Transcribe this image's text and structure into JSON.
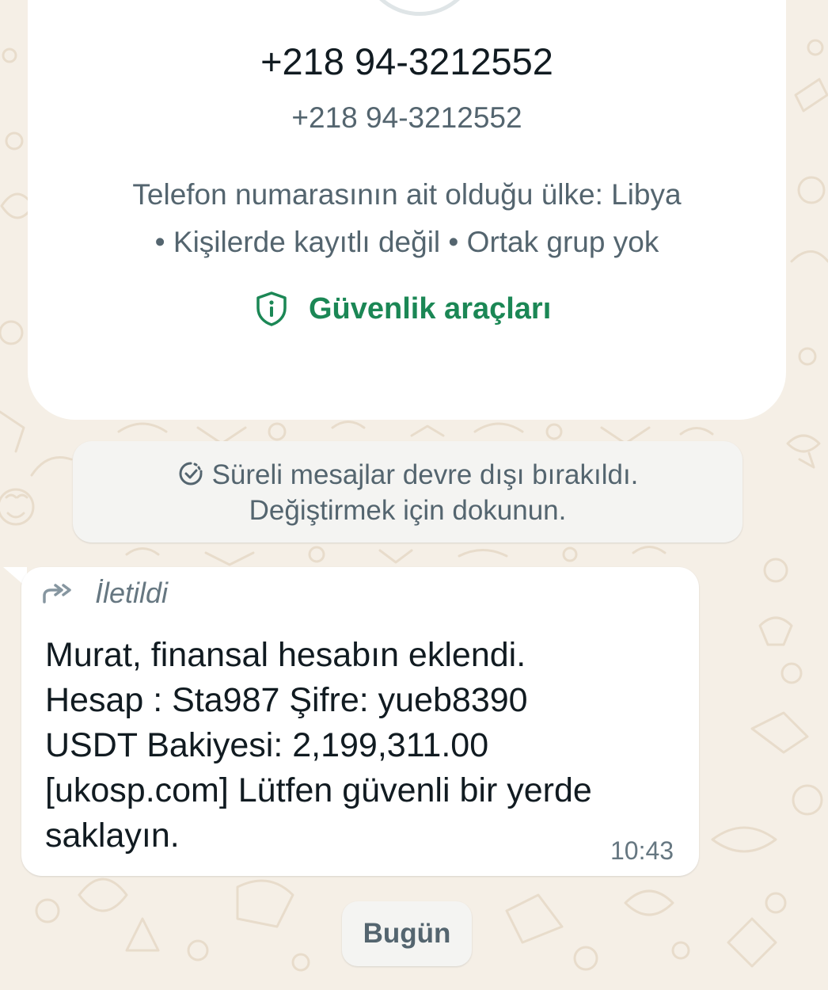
{
  "profile": {
    "name": "+218 94-3212552",
    "phone": "+218 94-3212552",
    "country_line": "Telefon numarasının ait olduğu ülke: Libya",
    "status_line": "• Kişilerde kayıtlı değil • Ortak grup yok",
    "safety_tools_label": "Güvenlik araçları",
    "safety_icon": "shield-info-icon",
    "accent_color": "#1b8755"
  },
  "system_message": {
    "line1": "Süreli mesajlar devre dışı bırakıldı.",
    "line2": "Değiştirmek için dokunun.",
    "icon": "timer-icon"
  },
  "message": {
    "forwarded_label": "İletildi",
    "forward_icon": "forward-arrow-icon",
    "lines": [
      "Murat, finansal hesabın eklendi.",
      "Hesap : Sta987 Şifre: yueb8390",
      "USDT Bakiyesi: 2,199,311.00",
      "[ukosp.com] Lütfen güvenli bir yerde",
      "saklayın."
    ],
    "time": "10:43"
  },
  "date_chip": {
    "label": "Bugün"
  },
  "colors": {
    "chat_background": "#f5efe6",
    "bubble": "#ffffff",
    "secondary_text": "#54656f"
  }
}
